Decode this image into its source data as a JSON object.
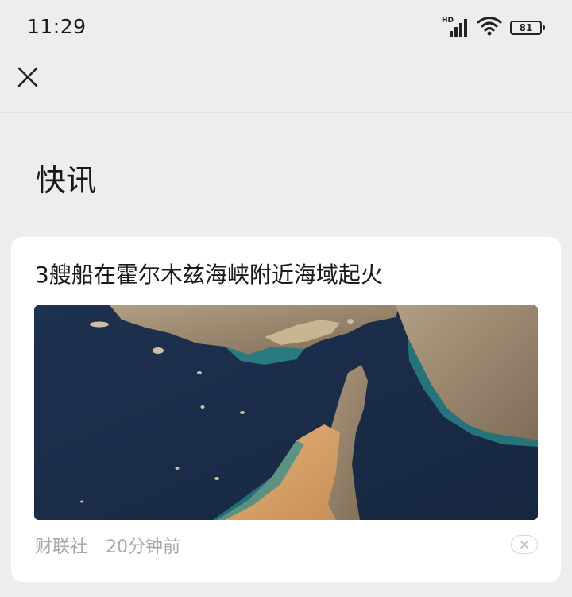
{
  "status_bar": {
    "time": "11:29",
    "network_label": "HD",
    "battery_level": "81",
    "icons": [
      "signal-icon",
      "wifi-icon",
      "battery-icon"
    ]
  },
  "header": {
    "close_icon": "close-icon"
  },
  "section": {
    "title": "快讯"
  },
  "news_card": {
    "title": "3艘船在霍尔木兹海峡附近海域起火",
    "image": "satellite-map-strait-of-hormuz",
    "source": "财联社",
    "time_ago": "20分钟前",
    "dismiss_icon": "close-icon"
  },
  "colors": {
    "background": "#ededed",
    "card": "#ffffff",
    "meta_text": "#a8a8a8",
    "sea": "#1b2d45",
    "land_desert": "#d9a56b",
    "land_rock": "#a08a6c",
    "coast_shallow": "#2e9a96"
  }
}
